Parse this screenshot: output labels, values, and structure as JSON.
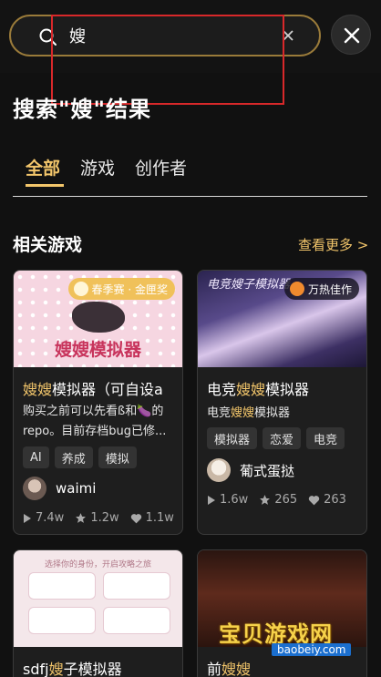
{
  "search": {
    "value": "嫂",
    "placeholder": ""
  },
  "header": {
    "title": "搜索\"嫂\"结果"
  },
  "tabs": [
    {
      "label": "全部",
      "active": true
    },
    {
      "label": "游戏",
      "active": false
    },
    {
      "label": "创作者",
      "active": false
    }
  ],
  "section": {
    "title": "相关游戏",
    "more": "查看更多 >"
  },
  "cards": [
    {
      "thumb_text": "嫂嫂模拟器",
      "badge": "春季赛 · 金匣奖",
      "title_hl": "嫂嫂",
      "title_rest": "模拟器（可自设a",
      "desc": "购买之前可以先看ß和🍆的repo。目前存档bug已修...",
      "tags": [
        "AI",
        "养成",
        "模拟"
      ],
      "author": "waimi",
      "plays": "7.4w",
      "stars": "1.2w",
      "likes": "1.1w"
    },
    {
      "thumb_text": "电竞嫂子模拟器",
      "badge": "万热佳作",
      "title_pre": "电竞",
      "title_hl": "嫂嫂",
      "title_rest": "模拟器",
      "subtitle_pre": "电竞",
      "subtitle_hl": "嫂嫂",
      "subtitle_rest": "模拟器",
      "tags": [
        "模拟器",
        "恋爱",
        "电竞"
      ],
      "author": "葡式蛋挞",
      "plays": "1.6w",
      "stars": "265",
      "likes": "263"
    },
    {
      "thumb_text": "选择你的身份，开启攻略之旅",
      "title_pre": "sdfj",
      "title_hl": "嫂",
      "title_rest": "子模拟器"
    },
    {
      "title_pre": "前",
      "title_hl": "嫂嫂",
      "title_rest": ""
    }
  ],
  "watermark": {
    "text": "宝贝游戏网",
    "url": "baobeiy.com"
  },
  "colors": {
    "accent": "#f3c66b",
    "background": "#111111",
    "card": "#1e1e1e",
    "annotation": "#d8282a"
  }
}
